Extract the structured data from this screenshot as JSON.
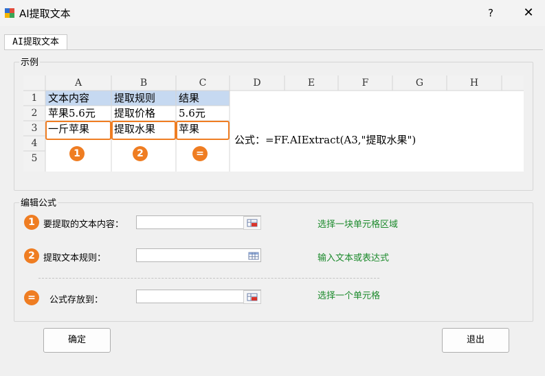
{
  "window": {
    "title": "AI提取文本",
    "help_label": "?",
    "close_label": "✕"
  },
  "tabs": [
    {
      "label": "AI提取文本"
    }
  ],
  "example": {
    "legend": "示例",
    "columns": [
      "A",
      "B",
      "C",
      "D",
      "E",
      "F",
      "G",
      "H"
    ],
    "rows": [
      "1",
      "2",
      "3",
      "4",
      "5"
    ],
    "cells": {
      "a1": "文本内容",
      "b1": "提取规则",
      "c1": "结果",
      "a2": "苹果5.6元",
      "b2": "提取价格",
      "c2": "5.6元",
      "a3": "一斤苹果",
      "b3": "提取水果",
      "c3": "苹果"
    },
    "badges": [
      "1",
      "2",
      "="
    ],
    "formula": "公式：=FF.AIExtract(A3,\"提取水果\")"
  },
  "editor": {
    "legend": "编辑公式",
    "rows": [
      {
        "badge": "1",
        "label": "要提取的文本内容：",
        "value": "",
        "hint": "选择一块单元格区域"
      },
      {
        "badge": "2",
        "label": "提取文本规则：",
        "value": "",
        "hint": "输入文本或表达式"
      },
      {
        "badge": "=",
        "label": "公式存放到：",
        "value": "",
        "hint": "选择一个单元格"
      }
    ]
  },
  "buttons": {
    "ok": "确定",
    "exit": "退出"
  },
  "colors": {
    "accent": "#ef7d22",
    "hint": "#1c8a2c",
    "header_fill": "#c6d9f1"
  }
}
